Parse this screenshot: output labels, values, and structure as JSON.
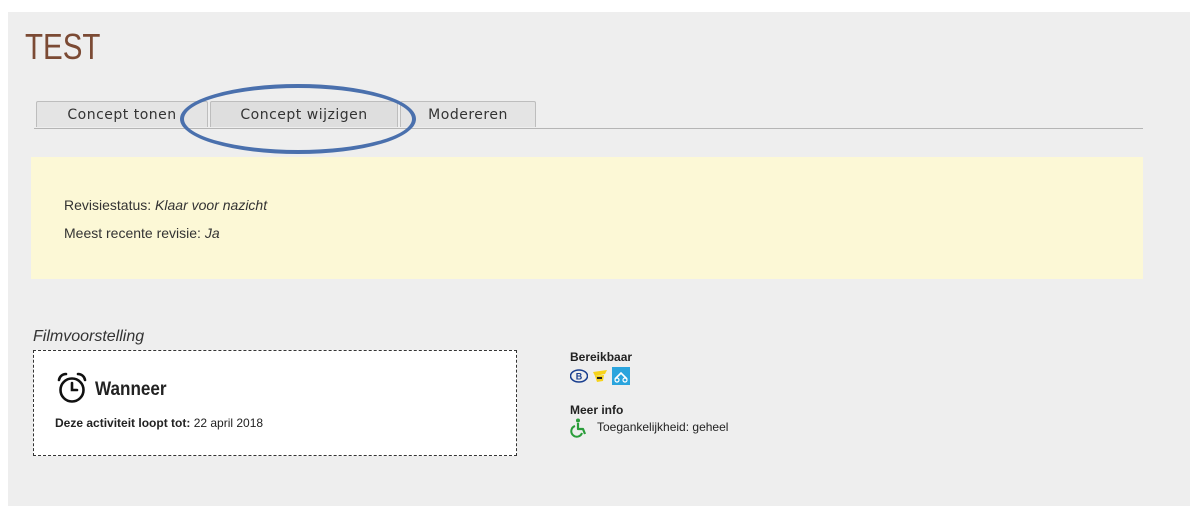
{
  "page": {
    "title": "TEST"
  },
  "tabs": [
    {
      "label": "Concept tonen"
    },
    {
      "label": "Concept wijzigen"
    },
    {
      "label": "Modereren"
    }
  ],
  "notice": {
    "status_label": "Revisiestatus:",
    "status_value": "Klaar voor nazicht",
    "recent_label": "Meest recente revisie:",
    "recent_value": "Ja"
  },
  "section": {
    "label": "Filmvoorstelling"
  },
  "when": {
    "title": "Wanneer",
    "until_label": "Deze activiteit loopt tot:",
    "until_value": "22 april 2018"
  },
  "reachability": {
    "title": "Bereikbaar",
    "icons": [
      "train-icon",
      "bus-icon",
      "bike-icon"
    ]
  },
  "more_info": {
    "title": "Meer info",
    "accessibility": "Toegankelijkheid: geheel"
  },
  "colors": {
    "title": "#7b4a34",
    "notice_bg": "#fcf8d6",
    "annotation": "#4a70ad",
    "access_icon": "#2a9d3a"
  }
}
